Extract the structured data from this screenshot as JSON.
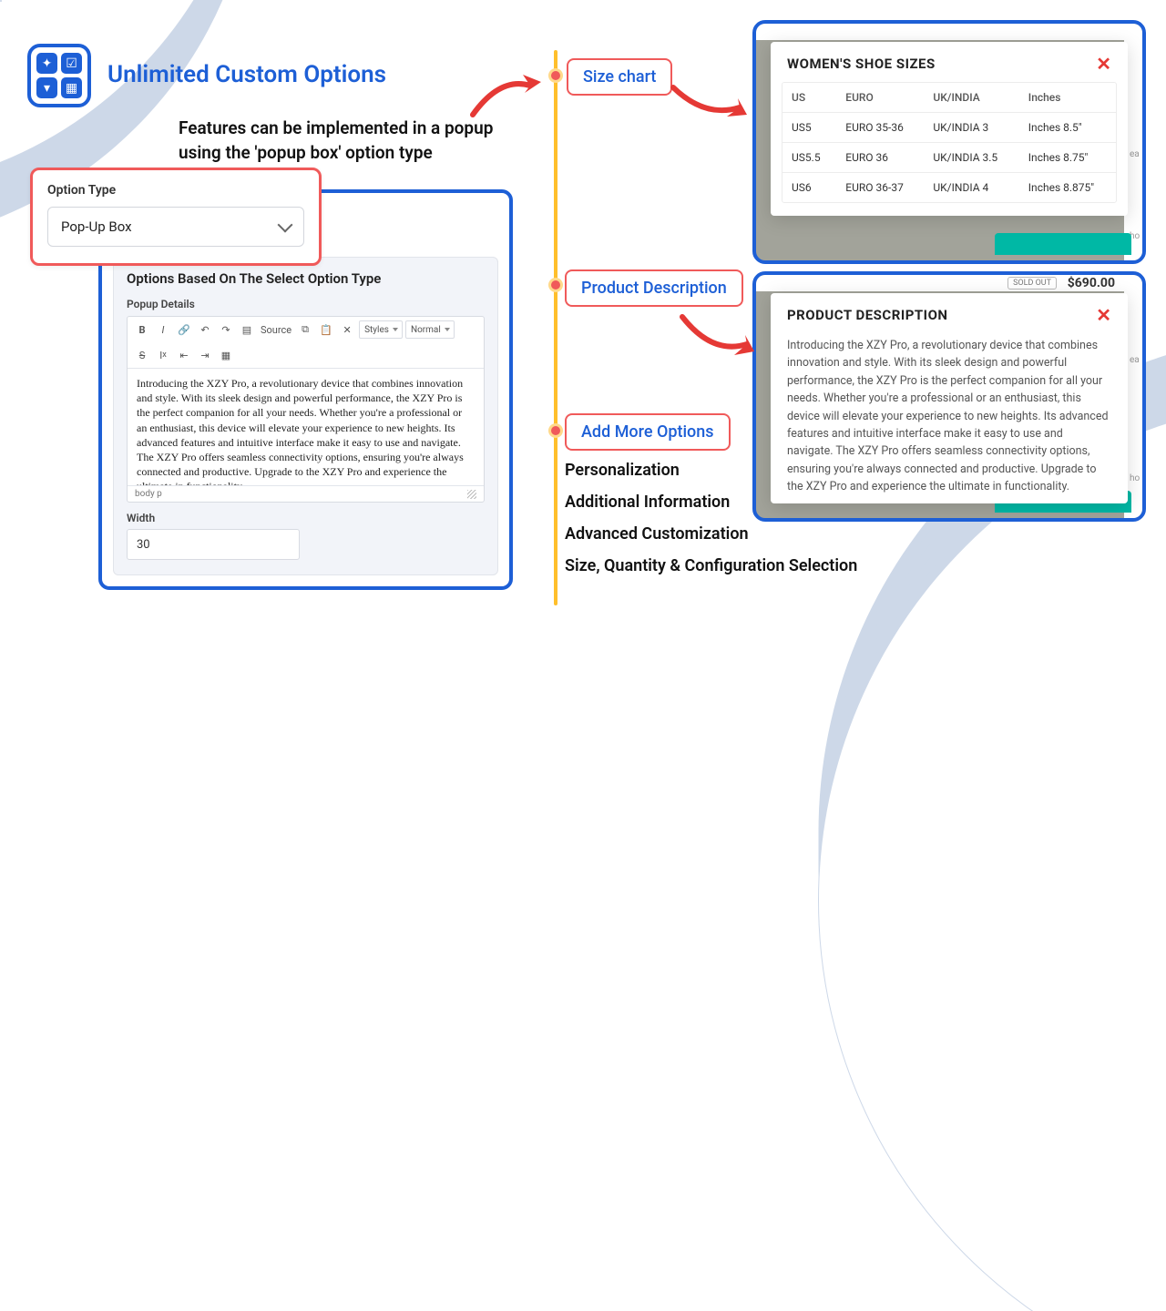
{
  "header": {
    "title": "Unlimited Custom Options",
    "subtitle": "Features can be implemented in a popup using the 'popup box' option type"
  },
  "option_type": {
    "label": "Option Type",
    "value": "Pop-Up Box"
  },
  "editor": {
    "title": "Options Based On The Select Option Type",
    "section_label": "Popup Details",
    "source_label": "Source",
    "styles_label": "Styles",
    "format_label": "Normal",
    "body": "Introducing the XZY Pro, a revolutionary device that combines innovation and style. With its sleek design and powerful performance, the XZY Pro is the perfect companion for all your needs. Whether you're a professional or an enthusiast, this device will elevate your experience to new heights. Its advanced features and intuitive interface make it easy to use and navigate. The XZY Pro offers seamless connectivity options, ensuring you're always connected and productive. Upgrade to the XZY Pro and experience the ultimate in functionality.",
    "status": "body  p",
    "width_label": "Width",
    "width_value": "30"
  },
  "timeline": {
    "t1": "Size chart",
    "t2": "Product Description",
    "t3": "Add More Options",
    "more": [
      "Personalization",
      "Additional Information",
      "Advanced Customization",
      "Size, Quantity & Configuration Selection"
    ]
  },
  "size_modal": {
    "title": "WOMEN'S SHOE SIZES",
    "headers": [
      "US",
      "EURO",
      "UK/INDIA",
      "Inches"
    ],
    "rows": [
      [
        "US5",
        "EURO 35-36",
        "UK/INDIA 3",
        "Inches 8.5\""
      ],
      [
        "US5.5",
        "EURO 36",
        "UK/INDIA 3.5",
        "Inches 8.75\""
      ],
      [
        "US6",
        "EURO 36-37",
        "UK/INDIA 4",
        "Inches 8.875\""
      ]
    ]
  },
  "desc_modal": {
    "title": "PRODUCT DESCRIPTION",
    "body": "Introducing the XZY Pro, a revolutionary device that combines innovation and style. With its sleek design and powerful performance, the XZY Pro is the perfect companion for all your needs. Whether you're a professional or an enthusiast, this device will elevate your experience to new heights. Its advanced features and intuitive interface make it easy to use and navigate. The XZY Pro offers seamless connectivity options, ensuring you're always connected and productive. Upgrade to the XZY Pro and experience the ultimate in functionality."
  },
  "frame": {
    "price1": "$690.00",
    "pill": "SOLD OUT",
    "side_labels": [
      "ea",
      "ho"
    ]
  }
}
